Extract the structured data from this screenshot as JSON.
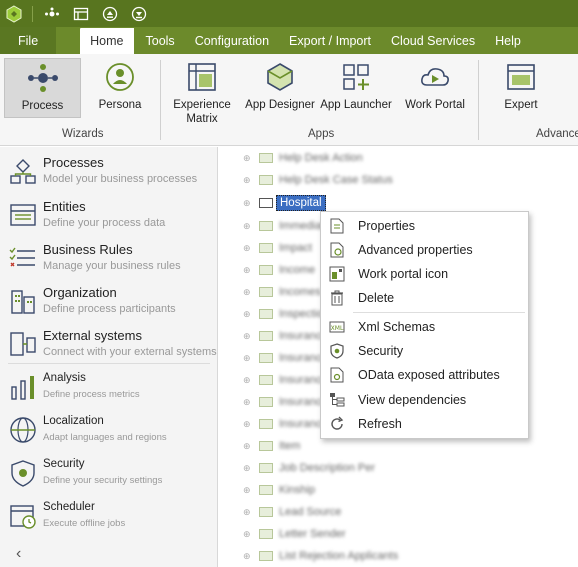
{
  "menu": {
    "file": "File",
    "home": "Home",
    "tools": "Tools",
    "configuration": "Configuration",
    "export_import": "Export / Import",
    "cloud_services": "Cloud Services",
    "help": "Help"
  },
  "ribbon": {
    "process": "Process",
    "persona": "Persona",
    "wizards_group": "Wizards",
    "experience_matrix_line1": "Experience",
    "experience_matrix_line2": "Matrix",
    "app_designer": "App Designer",
    "app_launcher": "App Launcher",
    "work_portal": "Work Portal",
    "apps_group": "Apps",
    "expert": "Expert",
    "advanced_group": "Advance"
  },
  "nav": {
    "processes": {
      "title": "Processes",
      "subtitle": "Model your business processes"
    },
    "entities": {
      "title": "Entities",
      "subtitle": "Define your process data"
    },
    "business_rules": {
      "title": "Business Rules",
      "subtitle": "Manage your business rules"
    },
    "organization": {
      "title": "Organization",
      "subtitle": "Define process participants"
    },
    "external_systems": {
      "title": "External systems",
      "subtitle": "Connect with your external systems"
    },
    "analysis": {
      "title": "Analysis",
      "subtitle": "Define process metrics"
    },
    "localization": {
      "title": "Localization",
      "subtitle": "Adapt languages and regions"
    },
    "security": {
      "title": "Security",
      "subtitle": "Define your security settings"
    },
    "scheduler": {
      "title": "Scheduler",
      "subtitle": "Execute offline jobs"
    },
    "collapse": "‹"
  },
  "tree": {
    "rows": [
      "Help Desk Action",
      "Help Desk Case Status",
      "Hospital",
      "Immediate",
      "Impact",
      "Income",
      "Incomes",
      "Inspection",
      "Insurance",
      "Insurance",
      "Insurance",
      "Insurance",
      "Insurance",
      "Item",
      "Job Description Per",
      "Kinship",
      "Lead Source",
      "Letter Sender",
      "List Rejection Applicants"
    ],
    "selected_label": "Hospital"
  },
  "context_menu": {
    "properties": "Properties",
    "advanced_properties": "Advanced properties",
    "work_portal_icon": "Work portal icon",
    "delete": "Delete",
    "xml_schemas": "Xml Schemas",
    "security": "Security",
    "odata": "OData exposed attributes",
    "view_dependencies": "View dependencies",
    "refresh": "Refresh"
  },
  "colors": {
    "titlebar": "#58751f",
    "menubar": "#6c8a2b",
    "selection": "#3b6ec2",
    "icon_green": "#6a8f2a"
  }
}
